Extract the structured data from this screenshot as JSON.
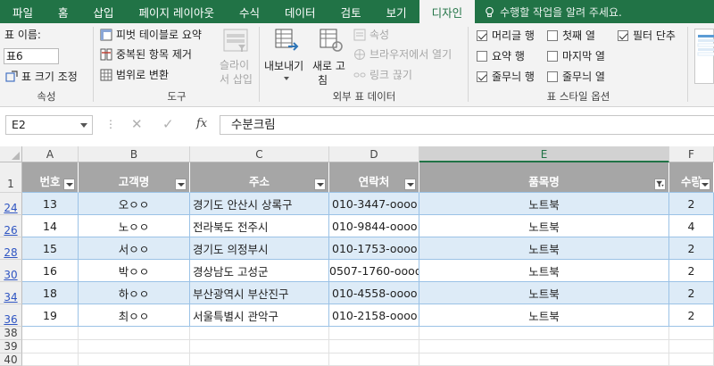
{
  "tabs": [
    "파일",
    "홈",
    "삽입",
    "페이지 레이아웃",
    "수식",
    "데이터",
    "검토",
    "보기",
    "디자인"
  ],
  "tell_me": "수행할 작업을 알려 주세요.",
  "ribbon": {
    "properties": {
      "table_name_label": "표 이름:",
      "table_name_value": "표6",
      "resize_label": "표 크기 조정",
      "group_label": "속성"
    },
    "tools": {
      "pivot": "피벗 테이블로 요약",
      "remove_dup": "중복된 항목 제거",
      "convert_range": "범위로 변환",
      "slicer_line1": "슬라이",
      "slicer_line2": "서 삽입",
      "group_label": "도구"
    },
    "external": {
      "export_line1": "내보내기",
      "refresh_line1": "새로 고",
      "refresh_line2": "침",
      "properties": "속성",
      "open_browser": "브라우저에서 열기",
      "unlink": "링크 끊기",
      "group_label": "외부 표 데이터"
    },
    "style_options": {
      "header_row": "머리글 행",
      "total_row": "요약 행",
      "banded_rows": "줄무늬 행",
      "first_column": "첫째 열",
      "last_column": "마지막 열",
      "banded_columns": "줄무늬 열",
      "filter_button": "필터 단추",
      "group_label": "표 스타일 옵션"
    }
  },
  "formula_bar": {
    "name_box": "E2",
    "cancel": "✕",
    "enter": "✓",
    "fx": "fx",
    "content": "수분크림"
  },
  "grid": {
    "columns": [
      "A",
      "B",
      "C",
      "D",
      "E",
      "F"
    ],
    "table_headers": [
      "번호",
      "고객명",
      "주소",
      "연락처",
      "품목명",
      "수량"
    ],
    "rows": [
      {
        "rownum": "24",
        "cells": [
          "13",
          "오ㅇㅇ",
          "경기도 안산시 상록구",
          "010-3447-oooo",
          "노트북",
          "2"
        ]
      },
      {
        "rownum": "26",
        "cells": [
          "14",
          "노ㅇㅇ",
          "전라북도 전주시",
          "010-9844-oooo",
          "노트북",
          "4"
        ]
      },
      {
        "rownum": "28",
        "cells": [
          "15",
          "서ㅇㅇ",
          "경기도 의정부시",
          "010-1753-oooo",
          "노트북",
          "2"
        ]
      },
      {
        "rownum": "30",
        "cells": [
          "16",
          "박ㅇㅇ",
          "경상남도 고성군",
          "0507-1760-oooo",
          "노트북",
          "2"
        ]
      },
      {
        "rownum": "34",
        "cells": [
          "18",
          "하ㅇㅇ",
          "부산광역시 부산진구",
          "010-4558-oooo",
          "노트북",
          "2"
        ]
      },
      {
        "rownum": "36",
        "cells": [
          "19",
          "최ㅇㅇ",
          "서울특별시 관악구",
          "010-2158-oooo",
          "노트북",
          "2"
        ]
      }
    ],
    "header_rownum": "1",
    "empty_rows": [
      "38",
      "39",
      "40"
    ]
  }
}
